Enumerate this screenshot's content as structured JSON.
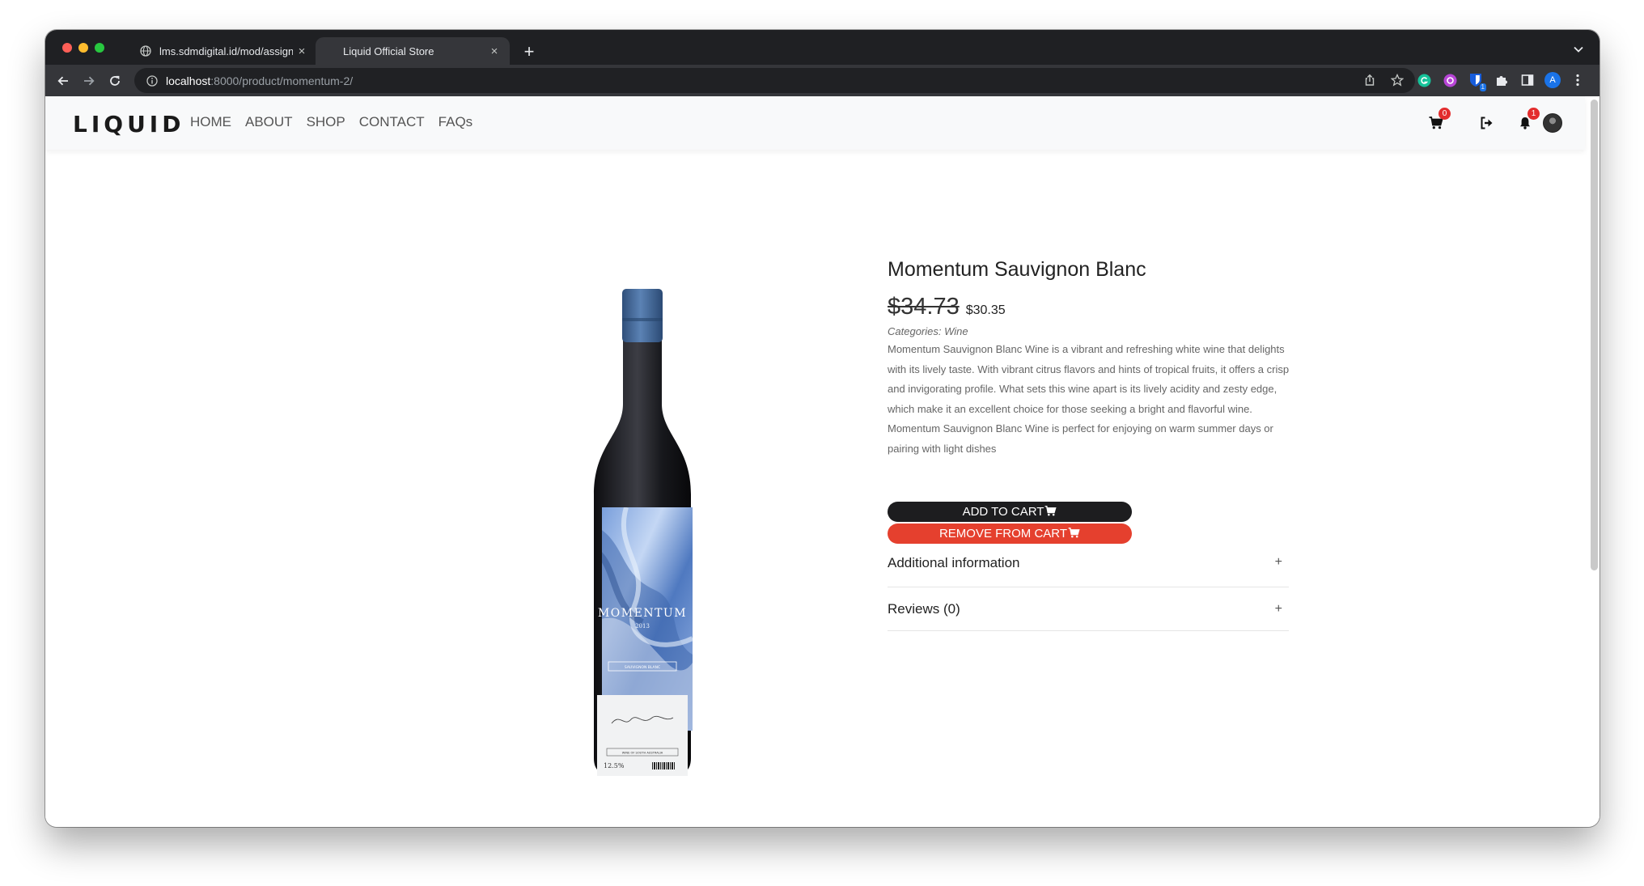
{
  "browser": {
    "tabs": [
      {
        "title": "lms.sdmdigital.id/mod/assign/v",
        "close": "×"
      },
      {
        "title": "Liquid Official Store",
        "close": "×"
      }
    ],
    "new_tab": "+",
    "url_host": "localhost",
    "url_path": ":8000/product/momentum-2/",
    "profile_initial": "A",
    "extension_badge": "1",
    "colors": {
      "frame": "#1f2023",
      "toolbar": "#35363a",
      "omnibox": "#202124"
    }
  },
  "site": {
    "logo": "LIQUID",
    "nav": [
      "HOME",
      "ABOUT",
      "SHOP",
      "CONTACT",
      "FAQs"
    ],
    "cart_count": "0",
    "notification_count": "1",
    "icons": [
      "cart-icon",
      "logout-icon",
      "bell-icon",
      "avatar"
    ]
  },
  "product": {
    "title": "Momentum Sauvignon Blanc",
    "price_old": "$34.73",
    "price_new": "$30.35",
    "categories": "Categories: Wine",
    "description": "Momentum Sauvignon Blanc Wine is a vibrant and refreshing white wine that delights with its lively taste. With vibrant citrus flavors and hints of tropical fruits, it offers a crisp and invigorating profile. What sets this wine apart is its lively acidity and zesty edge, which make it an excellent choice for those seeking a bright and flavorful wine. Momentum Sauvignon Blanc Wine is perfect for enjoying on warm summer days or pairing with light dishes",
    "add_to_cart": "ADD TO CART",
    "remove_from_cart": "REMOVE FROM CART",
    "accordion": [
      {
        "label": "Additional information",
        "toggle": "+"
      },
      {
        "label": "Reviews (0)",
        "toggle": "+"
      }
    ],
    "bottle_label": {
      "brand": "MOMENTUM",
      "year": "2013",
      "variety": "SAUVIGNON BLANC",
      "region": "WINE OF SOUTH AUSTRALIA",
      "abv": "12.5%"
    },
    "colors": {
      "add_button": "#1d1d1f",
      "remove_button": "#e5402e",
      "capsule": "#4a6fa0",
      "bottle": "#1b1c20"
    }
  }
}
